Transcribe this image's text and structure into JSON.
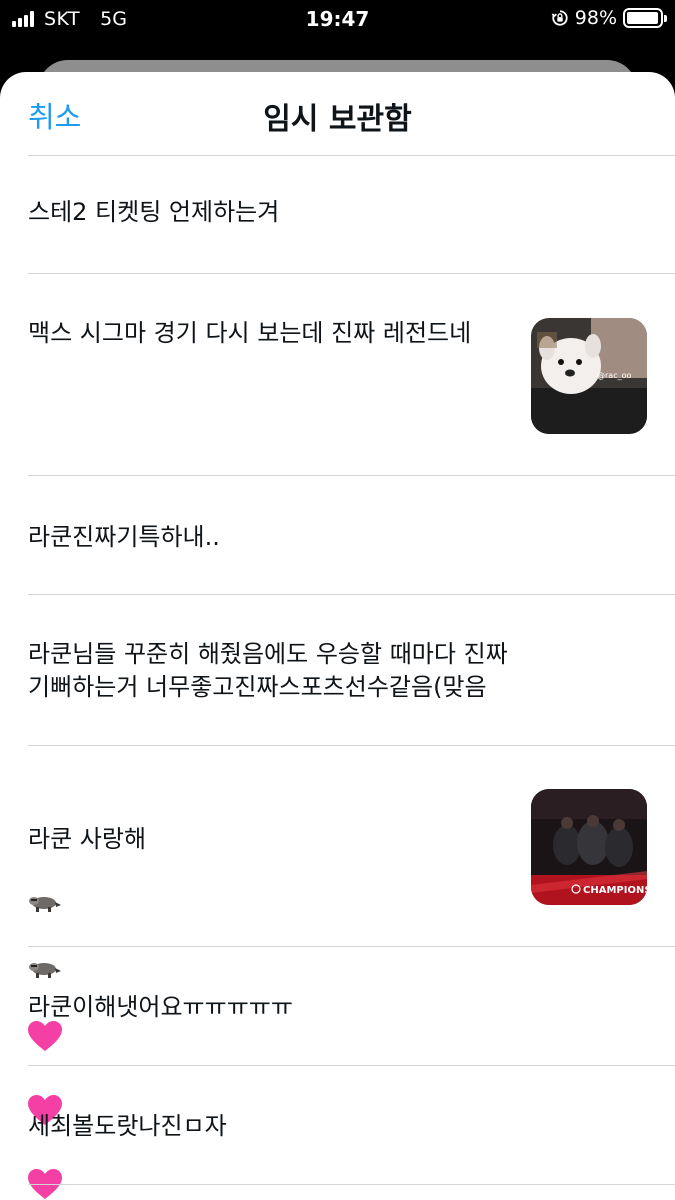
{
  "status_bar": {
    "carrier": "SKT",
    "network": "5G",
    "time": "19:47",
    "battery": "98%",
    "battery_level": 0.98
  },
  "header": {
    "cancel_label": "취소",
    "title": "임시 보관함"
  },
  "drafts": [
    {
      "text": "스테2 티켓팅 언제하는겨",
      "has_image": false
    },
    {
      "text": "맥스 시그마 경기 다시 보는데 진짜 레전드네",
      "has_image": true,
      "image": "puppy-photo",
      "image_caption": "@rac_oo"
    },
    {
      "text": "라쿤진짜기특하내..",
      "has_image": false
    },
    {
      "text": "라쿤님들 꾸준히 해줬음에도 우승할 때마다 진짜\n기뻐하는거 너무좋고진짜스포츠선수같음(맞음",
      "has_image": false
    },
    {
      "text": "라쿤 사랑해",
      "emojis": [
        "raccoon-emoji",
        "raccoon-emoji",
        "pink-heart-emoji",
        "pink-heart-emoji",
        "pink-heart-emoji"
      ],
      "has_image": true,
      "image": "champions-photo",
      "image_caption": "CHAMPIONS"
    },
    {
      "text": "라쿤이해냇어요ㅠㅠㅠㅠㅠ",
      "has_image": false
    },
    {
      "text": "세최볼도랏나진ㅁ자",
      "has_image": false
    }
  ]
}
